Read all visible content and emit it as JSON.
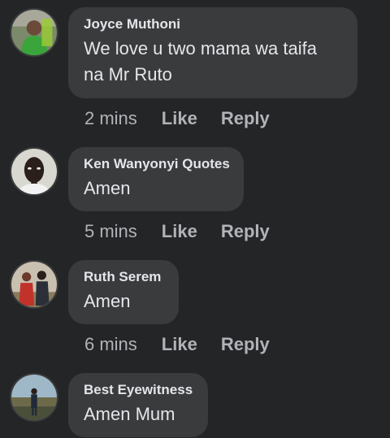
{
  "comments": [
    {
      "author": "Joyce Muthoni",
      "text": "We love u two mama wa taifa na Mr Ruto",
      "time": "2 mins",
      "like": "Like",
      "reply": "Reply"
    },
    {
      "author": "Ken Wanyonyi Quotes",
      "text": "Amen",
      "time": "5 mins",
      "like": "Like",
      "reply": "Reply"
    },
    {
      "author": "Ruth Serem",
      "text": "Amen",
      "time": "6 mins",
      "like": "Like",
      "reply": "Reply"
    },
    {
      "author": "Best Eyewitness",
      "text": "Amen Mum",
      "time": "",
      "like": "",
      "reply": ""
    }
  ],
  "colors": {
    "background": "#242526",
    "bubble": "#3a3b3c",
    "primary_text": "#e4e6eb",
    "secondary_text": "#b0b3b8"
  }
}
